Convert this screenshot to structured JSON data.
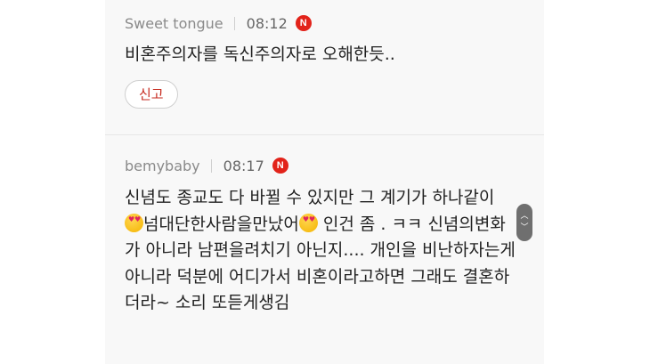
{
  "comments": [
    {
      "author": "Sweet tongue",
      "time": "08:12",
      "badge": "N",
      "text": "비혼주의자를 독신주의자로 오해한듯..",
      "report_label": "신고"
    },
    {
      "author": "bemybaby",
      "time": "08:17",
      "badge": "N",
      "text_part1": "신념도 종교도 다 바뀔 수 있지만 그 계기가 하나같이 ",
      "emoji_name": "heart-eyes-emoji",
      "text_part2": "넘대단한사람을만났어",
      "text_part3": " 인건 좀 . ㅋㅋ 신념의변화가 아니라 남편을려치기 아닌지.... 개인을 비난하자는게 아니라 덕분에 어디가서 비혼이라고하면 그래도 결혼하더라~ 소리 또듣게생김"
    }
  ],
  "scroll": {
    "up": "︿",
    "down": "﹀"
  },
  "colors": {
    "badge": "#e2231a",
    "report_text": "#c62a1f",
    "panel_bg": "#f8f8f8"
  }
}
